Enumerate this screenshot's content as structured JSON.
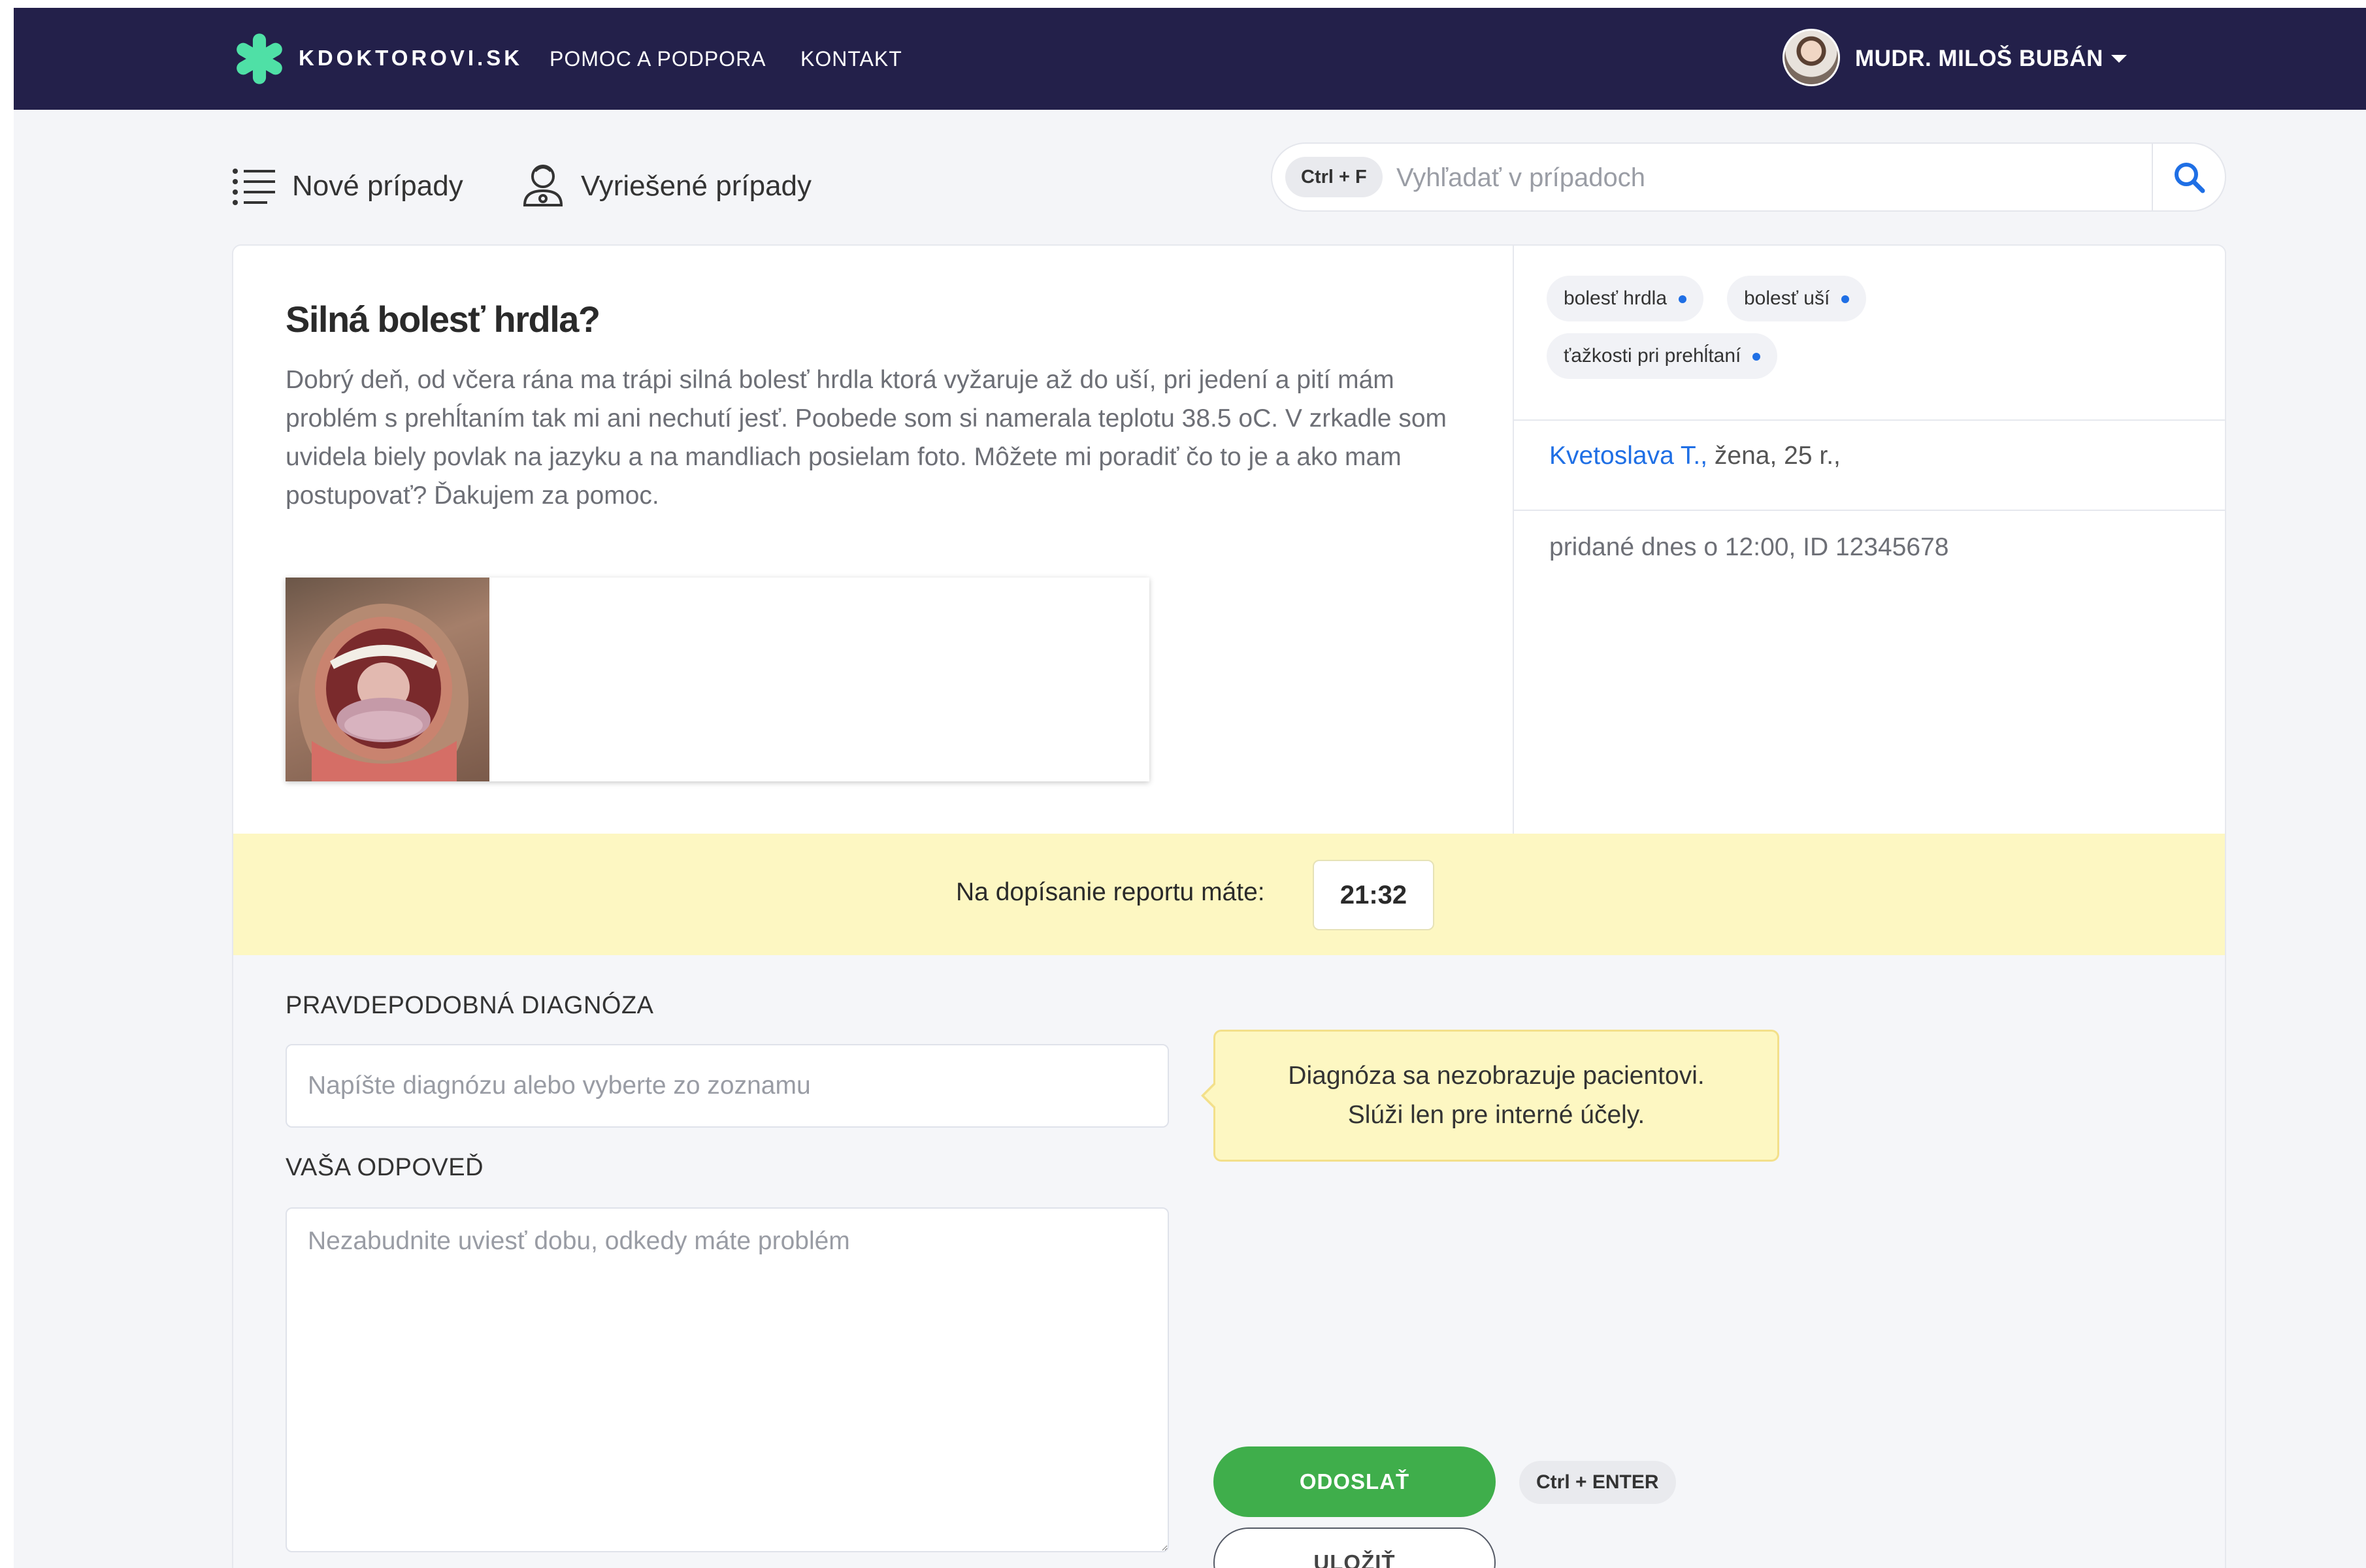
{
  "header": {
    "brand": "KDOKTOROVI.SK",
    "nav": [
      "POMOC A PODPORA",
      "KONTAKT"
    ],
    "user": "MUDR. MILOŠ BUBÁN"
  },
  "subnav": {
    "new_cases": "Nové prípady",
    "resolved_cases": "Vyriešené prípady"
  },
  "search": {
    "shortcut": "Ctrl + F",
    "placeholder": "Vyhľadať v prípadoch"
  },
  "case": {
    "title": "Silná bolesť hrdla?",
    "body": "Dobrý deň, od včera rána ma trápi silná bolesť hrdla ktorá vyžaruje až do uší, pri jedení a pití mám problém s prehĺtaním tak mi ani nechutí jesť. Poobede som si namerala teplotu 38.5 oC. V zrkadle som uvidela biely povlak na jazyku a na mandliach posielam foto. Môžete mi poradiť čo to je a ako mam postupovať? Ďakujem za pomoc.",
    "tags": [
      "bolesť hrdla",
      "bolesť uší",
      "ťažkosti pri prehĺtaní"
    ],
    "patient_name": "Kvetoslava T.,",
    "patient_info": " žena, 25 r.,",
    "added": "pridané dnes o 12:00, ID 12345678"
  },
  "timer": {
    "label": "Na dopísanie reportu máte:",
    "value": "21:32"
  },
  "form": {
    "diagnosis_label": "PRAVDEPODOBNÁ DIAGNÓZA",
    "diagnosis_placeholder": "Napíšte diagnózu alebo vyberte zo zoznamu",
    "answer_label": "VAŠA ODPOVEĎ",
    "answer_placeholder": "Nezabudnite uviesť dobu, odkedy máte problém",
    "note_line1": "Diagnóza sa nezobrazuje pacientovi.",
    "note_line2": "Slúži len pre interné účely.",
    "send_label": "ODOSLAŤ",
    "send_shortcut": "Ctrl + ENTER",
    "save_label": "ULOŽIŤ"
  },
  "colors": {
    "navbar": "#23204a",
    "accent_blue": "#1f6fe5",
    "logo_green": "#4fe0a6",
    "send_green": "#3fae4b",
    "timer_yellow": "#fdf7c2"
  },
  "icons": [
    "logo-icon",
    "list-icon",
    "doctor-icon",
    "search-icon",
    "chevron-down-icon"
  ]
}
